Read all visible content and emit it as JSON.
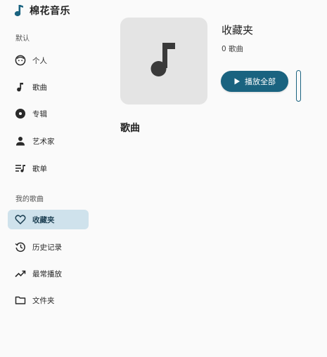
{
  "app": {
    "title": "棉花音乐",
    "accent": "#1a6380",
    "active_bg": "#cfe2ec"
  },
  "sidebar": {
    "default_section_label": "默认",
    "default_items": [
      {
        "label": "个人",
        "icon": "face-icon"
      },
      {
        "label": "歌曲",
        "icon": "music-note-icon"
      },
      {
        "label": "专辑",
        "icon": "album-icon"
      },
      {
        "label": "艺术家",
        "icon": "person-icon"
      },
      {
        "label": "歌单",
        "icon": "playlist-icon"
      }
    ],
    "my_section_label": "我的歌曲",
    "my_items": [
      {
        "label": "收藏夹",
        "icon": "heart-icon",
        "active": true
      },
      {
        "label": "历史记录",
        "icon": "history-icon"
      },
      {
        "label": "最常播放",
        "icon": "trending-up-icon"
      },
      {
        "label": "文件夹",
        "icon": "folder-icon"
      }
    ]
  },
  "main": {
    "playlist_title": "收藏夹",
    "song_count": "0 歌曲",
    "play_all_label": "播放全部",
    "songs_heading": "歌曲",
    "cover_icon": "music-note-icon"
  }
}
